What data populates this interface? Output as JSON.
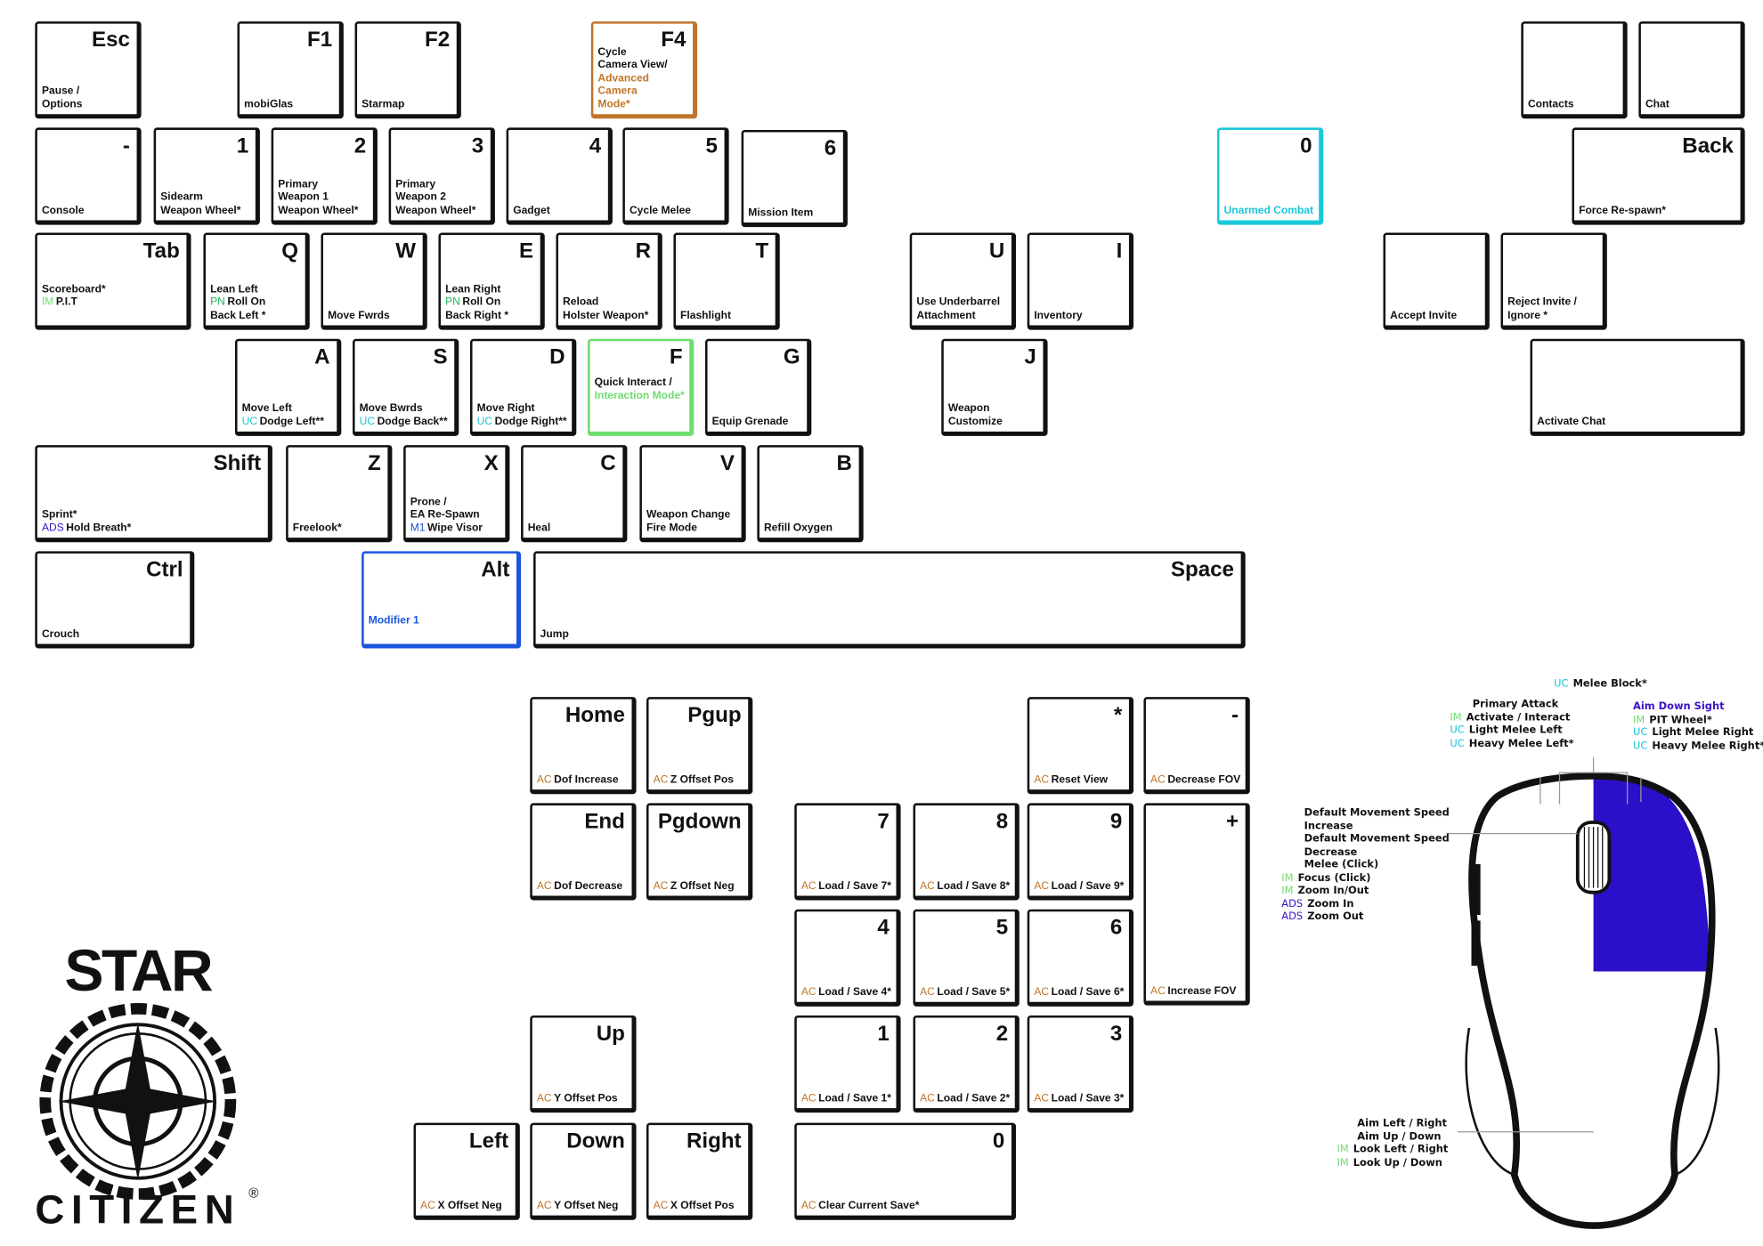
{
  "colors": {
    "AC": "#c0752a",
    "IM": "#6fdc6f",
    "PN": "#22b85a",
    "UC": "#19c3d6",
    "ADS": "#3a12c8",
    "M1": "#1a4fd8",
    "orange": "#c0752a",
    "green": "#6fdc6f",
    "cyan": "#19c8d8",
    "blue": "#1a55e0",
    "mouse_fill": "#2a10c8"
  },
  "keys": [
    {
      "id": "esc",
      "label": "Esc",
      "lines": [
        {
          "text": "Pause /"
        },
        {
          "text": "Options"
        }
      ]
    },
    {
      "id": "f1",
      "label": "F1",
      "lines": [
        {
          "text": "mobiGlas"
        }
      ]
    },
    {
      "id": "f2",
      "label": "F2",
      "lines": [
        {
          "text": "Starmap"
        }
      ]
    },
    {
      "id": "f4",
      "label": "F4",
      "border": "orange",
      "lines": [
        {
          "text": "Cycle"
        },
        {
          "text": "Camera View/"
        },
        {
          "text": "Advanced Camera",
          "color": "orange"
        },
        {
          "text": "Mode*",
          "color": "orange"
        }
      ]
    },
    {
      "id": "contacts",
      "label": "",
      "lines": [
        {
          "text": "Contacts"
        }
      ]
    },
    {
      "id": "chat",
      "label": "",
      "lines": [
        {
          "text": "Chat"
        }
      ]
    },
    {
      "id": "tilde",
      "label": "-",
      "lines": [
        {
          "text": "Console"
        }
      ]
    },
    {
      "id": "k1",
      "label": "1",
      "lines": [
        {
          "text": "Sidearm"
        },
        {
          "text": "Weapon Wheel*"
        }
      ]
    },
    {
      "id": "k2",
      "label": "2",
      "lines": [
        {
          "text": "Primary"
        },
        {
          "text": "Weapon 1"
        },
        {
          "text": "Weapon Wheel*"
        }
      ]
    },
    {
      "id": "k3",
      "label": "3",
      "lines": [
        {
          "text": "Primary"
        },
        {
          "text": "Weapon 2"
        },
        {
          "text": "Weapon Wheel*"
        }
      ]
    },
    {
      "id": "k4",
      "label": "4",
      "lines": [
        {
          "text": "Gadget"
        }
      ]
    },
    {
      "id": "k5",
      "label": "5",
      "lines": [
        {
          "text": "Cycle Melee"
        }
      ]
    },
    {
      "id": "k6",
      "label": "6",
      "lines": [
        {
          "text": "Mission Item"
        }
      ]
    },
    {
      "id": "k0",
      "label": "0",
      "border": "cyan",
      "lines": [
        {
          "text": "Unarmed Combat",
          "color": "cyan"
        }
      ]
    },
    {
      "id": "back",
      "label": "Back",
      "lines": [
        {
          "text": "Force Re-spawn*"
        }
      ]
    },
    {
      "id": "tab",
      "label": "Tab",
      "lines": [
        {
          "text": "Scoreboard*"
        },
        {
          "pre": "IM",
          "text": "P.I.T"
        },
        {
          "text": ""
        }
      ]
    },
    {
      "id": "q",
      "label": "Q",
      "lines": [
        {
          "text": "Lean Left"
        },
        {
          "pre": "PN",
          "text": "Roll On"
        },
        {
          "text": "Back Left *"
        }
      ]
    },
    {
      "id": "w",
      "label": "W",
      "lines": [
        {
          "text": "Move Fwrds"
        }
      ]
    },
    {
      "id": "e",
      "label": "E",
      "lines": [
        {
          "text": "Lean Right"
        },
        {
          "pre": "PN",
          "text": "Roll On"
        },
        {
          "text": "Back Right *"
        }
      ]
    },
    {
      "id": "r",
      "label": "R",
      "lines": [
        {
          "text": "Reload"
        },
        {
          "text": "Holster Weapon*"
        }
      ]
    },
    {
      "id": "t",
      "label": "T",
      "lines": [
        {
          "text": "Flashlight"
        }
      ]
    },
    {
      "id": "u",
      "label": "U",
      "lines": [
        {
          "text": "Use Underbarrel"
        },
        {
          "text": "Attachment"
        }
      ]
    },
    {
      "id": "i",
      "label": "I",
      "lines": [
        {
          "text": "Inventory"
        }
      ]
    },
    {
      "id": "accept",
      "label": "",
      "lines": [
        {
          "text": "Accept Invite"
        }
      ]
    },
    {
      "id": "reject",
      "label": "",
      "lines": [
        {
          "text": "Reject Invite /"
        },
        {
          "text": "Ignore *"
        }
      ]
    },
    {
      "id": "a",
      "label": "A",
      "lines": [
        {
          "text": "Move Left"
        },
        {
          "pre": "UC",
          "text": "Dodge Left**"
        }
      ]
    },
    {
      "id": "s",
      "label": "S",
      "lines": [
        {
          "text": "Move Bwrds"
        },
        {
          "pre": "UC",
          "text": "Dodge Back**"
        }
      ]
    },
    {
      "id": "d",
      "label": "D",
      "lines": [
        {
          "text": "Move Right"
        },
        {
          "pre": "UC",
          "text": "Dodge Right**"
        }
      ]
    },
    {
      "id": "f",
      "label": "F",
      "border": "green",
      "lines": [
        {
          "text": "Quick Interact /"
        },
        {
          "text": "Interaction Mode*",
          "color": "green"
        },
        {
          "text": ""
        },
        {
          "text": ""
        }
      ]
    },
    {
      "id": "g",
      "label": "G",
      "lines": [
        {
          "text": "Equip Grenade"
        }
      ]
    },
    {
      "id": "j",
      "label": "J",
      "lines": [
        {
          "text": "Weapon"
        },
        {
          "text": "Customize"
        }
      ]
    },
    {
      "id": "activate-chat",
      "label": "",
      "lines": [
        {
          "text": "Activate Chat"
        }
      ]
    },
    {
      "id": "shift",
      "label": "Shift",
      "lines": [
        {
          "text": "Sprint*"
        },
        {
          "pre": "ADS",
          "text": "Hold Breath*"
        }
      ]
    },
    {
      "id": "z",
      "label": "Z",
      "lines": [
        {
          "text": "Freelook*"
        }
      ]
    },
    {
      "id": "x",
      "label": "X",
      "lines": [
        {
          "text": "Prone /"
        },
        {
          "text": "EA Re-Spawn"
        },
        {
          "pre": "M1",
          "text": "Wipe Visor"
        }
      ]
    },
    {
      "id": "c",
      "label": "C",
      "lines": [
        {
          "text": "Heal"
        }
      ]
    },
    {
      "id": "v",
      "label": "V",
      "lines": [
        {
          "text": "Weapon Change"
        },
        {
          "text": "Fire Mode"
        }
      ]
    },
    {
      "id": "b",
      "label": "B",
      "lines": [
        {
          "text": "Refill Oxygen"
        }
      ]
    },
    {
      "id": "ctrl",
      "label": "Ctrl",
      "lines": [
        {
          "text": "Crouch"
        }
      ]
    },
    {
      "id": "alt",
      "label": "Alt",
      "border": "blue",
      "lines": [
        {
          "text": "Modifier 1",
          "color": "blue"
        },
        {
          "text": ""
        }
      ]
    },
    {
      "id": "space",
      "label": "Space",
      "lines": [
        {
          "text": "Jump"
        }
      ]
    },
    {
      "id": "home",
      "label": "Home",
      "lines": [
        {
          "pre": "AC",
          "text": "Dof Increase"
        }
      ]
    },
    {
      "id": "pgup",
      "label": "Pgup",
      "lines": [
        {
          "pre": "AC",
          "text": "Z Offset Pos"
        }
      ]
    },
    {
      "id": "end",
      "label": "End",
      "lines": [
        {
          "pre": "AC",
          "text": "Dof Decrease"
        }
      ]
    },
    {
      "id": "pgdown",
      "label": "Pgdown",
      "lines": [
        {
          "pre": "AC",
          "text": "Z Offset Neg"
        }
      ]
    },
    {
      "id": "up",
      "label": "Up",
      "lines": [
        {
          "pre": "AC",
          "text": "Y Offset Pos"
        }
      ]
    },
    {
      "id": "left",
      "label": "Left",
      "lines": [
        {
          "pre": "AC",
          "text": "X Offset Neg"
        }
      ]
    },
    {
      "id": "down",
      "label": "Down",
      "lines": [
        {
          "pre": "AC",
          "text": "Y Offset Neg"
        }
      ]
    },
    {
      "id": "right",
      "label": "Right",
      "lines": [
        {
          "pre": "AC",
          "text": "X Offset Pos"
        }
      ]
    },
    {
      "id": "np-mul",
      "label": "*",
      "lines": [
        {
          "pre": "AC",
          "text": "Reset View"
        }
      ]
    },
    {
      "id": "np-minus",
      "label": "-",
      "lines": [
        {
          "pre": "AC",
          "text": "Decrease FOV"
        }
      ]
    },
    {
      "id": "np7",
      "label": "7",
      "lines": [
        {
          "pre": "AC",
          "text": "Load / Save 7*"
        }
      ]
    },
    {
      "id": "np8",
      "label": "8",
      "lines": [
        {
          "pre": "AC",
          "text": "Load / Save 8*"
        }
      ]
    },
    {
      "id": "np9",
      "label": "9",
      "lines": [
        {
          "pre": "AC",
          "text": "Load / Save 9*"
        }
      ]
    },
    {
      "id": "np-plus",
      "label": "+",
      "lines": [
        {
          "pre": "AC",
          "text": "Increase FOV"
        }
      ]
    },
    {
      "id": "np4",
      "label": "4",
      "lines": [
        {
          "pre": "AC",
          "text": "Load / Save 4*"
        }
      ]
    },
    {
      "id": "np5",
      "label": "5",
      "lines": [
        {
          "pre": "AC",
          "text": "Load / Save 5*"
        }
      ]
    },
    {
      "id": "np6",
      "label": "6",
      "lines": [
        {
          "pre": "AC",
          "text": "Load / Save 6*"
        }
      ]
    },
    {
      "id": "np1",
      "label": "1",
      "lines": [
        {
          "pre": "AC",
          "text": "Load / Save 1*"
        }
      ]
    },
    {
      "id": "np2",
      "label": "2",
      "lines": [
        {
          "pre": "AC",
          "text": "Load / Save 2*"
        }
      ]
    },
    {
      "id": "np3",
      "label": "3",
      "lines": [
        {
          "pre": "AC",
          "text": "Load / Save 3*"
        }
      ]
    },
    {
      "id": "np0",
      "label": "0",
      "lines": [
        {
          "pre": "AC",
          "text": "Clear Current Save*"
        }
      ]
    }
  ],
  "mouse": {
    "middle": [
      {
        "pre": "UC",
        "text": "Melee Block*"
      }
    ],
    "left_button": [
      {
        "text": "Primary Attack"
      },
      {
        "pre": "IM",
        "text": "Activate / Interact"
      },
      {
        "pre": "UC",
        "text": "Light Melee Left"
      },
      {
        "pre": "UC",
        "text": "Heavy Melee Left*"
      }
    ],
    "right_button": [
      {
        "text": "Aim Down Sight",
        "color": "ADS"
      },
      {
        "pre": "IM",
        "text": "PIT Wheel*"
      },
      {
        "pre": "UC",
        "text": "Light Melee Right"
      },
      {
        "pre": "UC",
        "text": "Heavy Melee Right*"
      }
    ],
    "wheel": [
      {
        "text": "Default Movement Speed"
      },
      {
        "text": "Increase"
      },
      {
        "text": "Default Movement Speed"
      },
      {
        "text": "Decrease"
      },
      {
        "text": "Melee (Click)"
      },
      {
        "pre": "IM",
        "text": "Focus (Click)"
      },
      {
        "pre": "IM",
        "text": "Zoom In/Out"
      },
      {
        "pre": "ADS",
        "text": "Zoom In"
      },
      {
        "pre": "ADS",
        "text": "Zoom Out"
      }
    ],
    "movement": [
      {
        "text": "Aim Left / Right"
      },
      {
        "text": "Aim Up / Down"
      },
      {
        "pre": "IM",
        "text": "Look Left / Right"
      },
      {
        "pre": "IM",
        "text": "Look Up / Down"
      }
    ]
  },
  "logo": {
    "top": "STAR",
    "bottom": "CITIZEN",
    "mark": "®"
  }
}
